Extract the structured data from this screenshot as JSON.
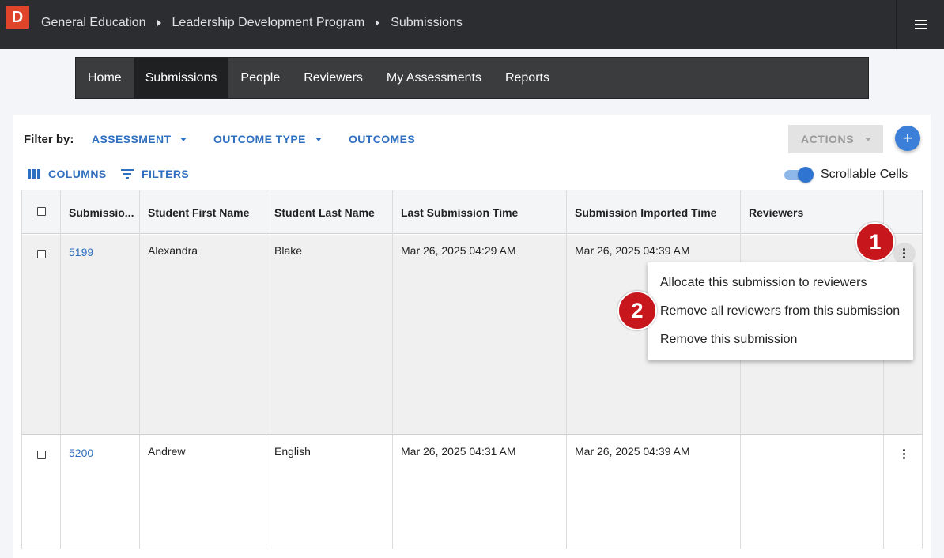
{
  "app": {
    "logo_letter": "D"
  },
  "breadcrumbs": [
    "General Education",
    "Leadership Development Program",
    "Submissions"
  ],
  "nav": {
    "items": [
      "Home",
      "Submissions",
      "People",
      "Reviewers",
      "My Assessments",
      "Reports"
    ],
    "active": "Submissions"
  },
  "filters": {
    "label": "Filter by:",
    "assessment": "ASSESSMENT",
    "outcome_type": "OUTCOME TYPE",
    "outcomes": "OUTCOMES"
  },
  "toolbar": {
    "actions": "ACTIONS",
    "add": "+",
    "columns": "COLUMNS",
    "filters": "FILTERS",
    "scrollable_cells_label": "Scrollable Cells",
    "scrollable_cells_on": true
  },
  "table": {
    "headers": [
      "Submissio...",
      "Student First Name",
      "Student Last Name",
      "Last Submission Time",
      "Submission Imported Time",
      "Reviewers"
    ],
    "rows": [
      {
        "id": "5199",
        "first": "Alexandra",
        "last": "Blake",
        "last_submission": "Mar 26, 2025 04:29 AM",
        "imported": "Mar 26, 2025 04:39 AM",
        "reviewers": ""
      },
      {
        "id": "5200",
        "first": "Andrew",
        "last": "English",
        "last_submission": "Mar 26, 2025 04:31 AM",
        "imported": "Mar 26, 2025 04:39 AM",
        "reviewers": ""
      }
    ]
  },
  "row_menu": {
    "items": [
      "Allocate this submission to reviewers",
      "Remove all reviewers from this submission",
      "Remove this submission"
    ]
  },
  "callouts": [
    "1",
    "2"
  ],
  "colors": {
    "accent": "#2f6fbf",
    "topbar": "#2b2d30",
    "logo": "#e0442a",
    "callout": "#c8161d"
  }
}
